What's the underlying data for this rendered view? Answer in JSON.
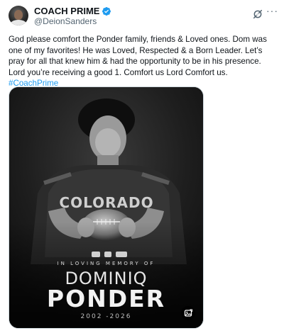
{
  "author": {
    "display_name": "COACH PRIME",
    "handle": "@DeionSanders",
    "verified_icon": "verified-badge-icon",
    "verified_color": "#1d9bf0"
  },
  "actions": {
    "grok_icon": "grok-icon",
    "more_icon": "more-options-icon",
    "more_label": "···"
  },
  "tweet": {
    "text": "God please comfort the Ponder family, friends & Loved ones. Dom was one of my favorites! He was Loved, Respected & a Born Leader. Let’s pray for all that knew him & had the opportunity to be in his presence. Lord you’re receiving a good 1. Comfort us Lord Comfort us. ",
    "hashtag": "#CoachPrime",
    "hashtag_color": "#1d9bf0"
  },
  "media": {
    "jersey_text": "COLORADO",
    "memory_line": "IN LOVING MEMORY OF",
    "first_name": "DOMINIQ",
    "last_name": "PONDER",
    "years": "2002 -2026",
    "alt_icon": "image-alt-icon"
  }
}
